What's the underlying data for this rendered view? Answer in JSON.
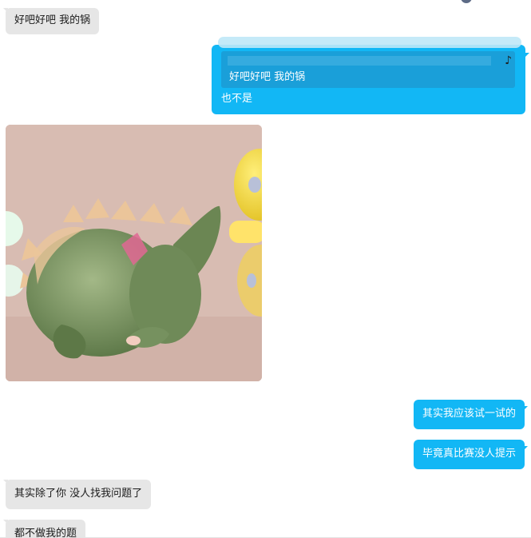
{
  "messages": {
    "m1": "好吧好吧  我的锅",
    "quote_text": "好吧好吧  我的锅",
    "reply_text": "也不是",
    "m4": "其实我应该试一试的",
    "m5": "毕竟真比赛没人提示",
    "m6": "其实除了你  没人找我问题了",
    "m7": "都不做我的题"
  },
  "icons": {
    "quote_icon": "music-note-icon",
    "quote_glyph": "♪"
  },
  "colors": {
    "incoming_bubble": "#e6e6e6",
    "outgoing_bubble": "#12b7f5",
    "quote_box": "#1a9fd9"
  }
}
